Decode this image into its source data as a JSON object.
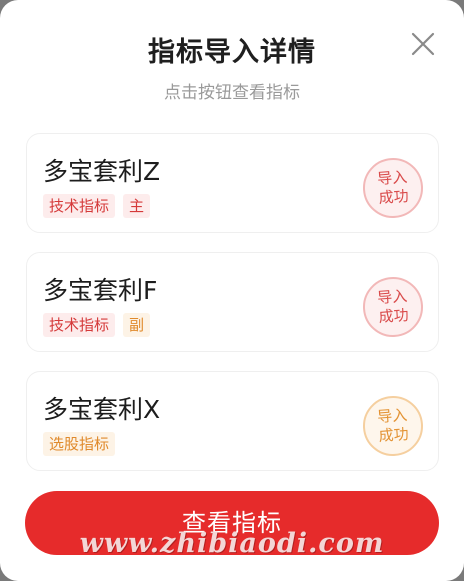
{
  "header": {
    "title": "指标导入详情",
    "subtitle": "点击按钮查看指标"
  },
  "close_icon": "close-icon",
  "indicators": [
    {
      "name": "多宝套利Z",
      "tags": [
        {
          "label": "技术指标",
          "color": "#d53a3a"
        },
        {
          "label": "主",
          "color": "#d53a3a"
        }
      ],
      "status": "导入成功",
      "status_color": "#d94a4a"
    },
    {
      "name": "多宝套利F",
      "tags": [
        {
          "label": "技术指标",
          "color": "#d53a3a"
        },
        {
          "label": "副",
          "color": "#e08a2c"
        }
      ],
      "status": "导入成功",
      "status_color": "#d94a4a"
    },
    {
      "name": "多宝套利X",
      "tags": [
        {
          "label": "选股指标",
          "color": "#e08a2c"
        }
      ],
      "status": "导入成功",
      "status_color": "#e39334"
    }
  ],
  "primary_button": {
    "label": "查看指标",
    "color": "#e62b2b"
  },
  "watermark": "www.zhibiaodi.com"
}
